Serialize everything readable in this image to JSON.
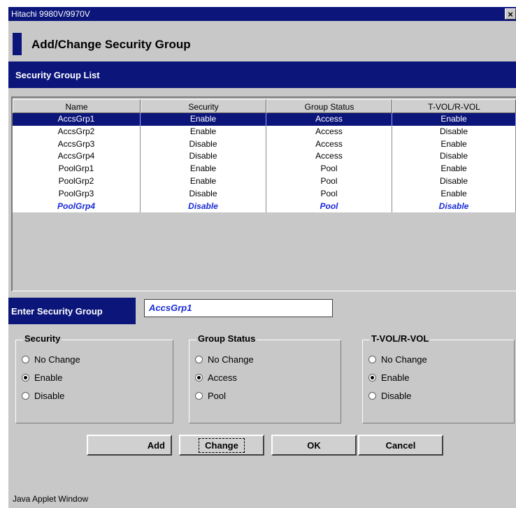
{
  "window": {
    "title": "Hitachi 9980V/9970V",
    "close_glyph": "×"
  },
  "page_title": "Add/Change Security Group",
  "list": {
    "label": "Security Group List",
    "columns": [
      "Name",
      "Security",
      "Group Status",
      "T-VOL/R-VOL"
    ],
    "rows": [
      [
        "AccsGrp1",
        "Enable",
        "Access",
        "Enable"
      ],
      [
        "AccsGrp2",
        "Enable",
        "Access",
        "Disable"
      ],
      [
        "AccsGrp3",
        "Disable",
        "Access",
        "Enable"
      ],
      [
        "AccsGrp4",
        "Disable",
        "Access",
        "Disable"
      ],
      [
        "PoolGrp1",
        "Enable",
        "Pool",
        "Enable"
      ],
      [
        "PoolGrp2",
        "Enable",
        "Pool",
        "Disable"
      ],
      [
        "PoolGrp3",
        "Disable",
        "Pool",
        "Enable"
      ],
      [
        "PoolGrp4",
        "Disable",
        "Pool",
        "Disable"
      ]
    ],
    "selected_row": 0,
    "new_row": 7
  },
  "enter": {
    "label": "Enter Security Group",
    "value": "AccsGrp1"
  },
  "groups": {
    "security": {
      "legend": "Security",
      "options": [
        "No Change",
        "Enable",
        "Disable"
      ],
      "selected": "Enable"
    },
    "group_status": {
      "legend": "Group Status",
      "options": [
        "No Change",
        "Access",
        "Pool"
      ],
      "selected": "Access"
    },
    "tvol": {
      "legend": "T-VOL/R-VOL",
      "options": [
        "No Change",
        "Enable",
        "Disable"
      ],
      "selected": "Enable"
    }
  },
  "buttons": {
    "add": "Add",
    "change": "Change",
    "ok": "OK",
    "cancel": "Cancel"
  },
  "footer": "Java Applet Window",
  "colors": {
    "title_bar": "#0b157a",
    "background": "#c8c8c8",
    "new_row_text": "#1a2bd6"
  }
}
